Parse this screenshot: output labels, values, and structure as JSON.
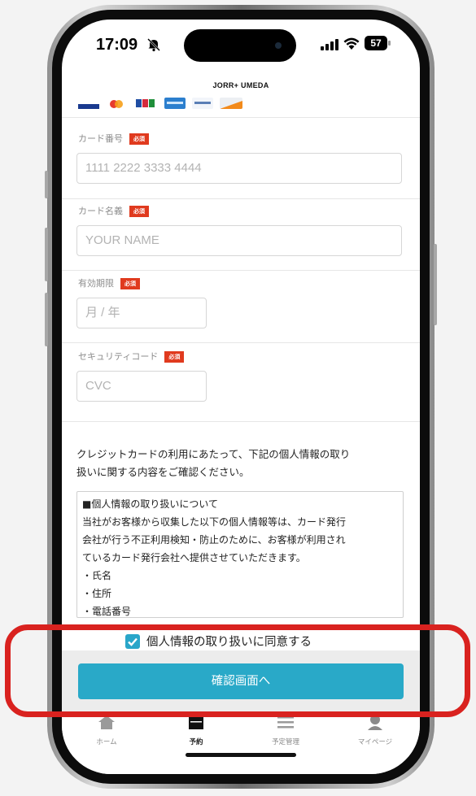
{
  "status_bar": {
    "time": "17:09",
    "battery": "57"
  },
  "header": {
    "title": "JORR+ UMEDA"
  },
  "brands": [
    "visa-logo",
    "mastercard-logo",
    "jcb-logo",
    "amex-logo",
    "diners-logo",
    "discover-logo"
  ],
  "form": {
    "required_badge": "必須",
    "card_number": {
      "label": "カード番号",
      "placeholder": "1111 2222 3333 4444"
    },
    "card_name": {
      "label": "カード名義",
      "placeholder": "YOUR NAME"
    },
    "expiry": {
      "label": "有効期限",
      "placeholder": "月 / 年"
    },
    "cvc": {
      "label": "セキュリティコード",
      "placeholder": "CVC"
    }
  },
  "notice": {
    "line1": "クレジットカードの利用にあたって、下記の個人情報の取り",
    "line2": "扱いに関する内容をご確認ください。"
  },
  "policy": {
    "lines": [
      "■個人情報の取り扱いについて",
      "当社がお客様から収集した以下の個人情報等は、カード発行",
      "会社が行う不正利用検知・防止のために、お客様が利用され",
      "ているカード発行会社へ提供させていただきます。",
      "・氏名",
      "・住所",
      "・電話番号"
    ]
  },
  "agree": {
    "label": "個人情報の取り扱いに同意する",
    "checked": true
  },
  "confirm_button": {
    "label": "確認画面へ"
  },
  "tabs": [
    {
      "label": "ホーム",
      "icon": "home-icon",
      "active": false
    },
    {
      "label": "予約",
      "icon": "calendar-icon",
      "active": true
    },
    {
      "label": "予定管理",
      "icon": "list-icon",
      "active": false
    },
    {
      "label": "マイページ",
      "icon": "person-icon",
      "active": false
    }
  ],
  "colors": {
    "accent": "#29a9c8",
    "required": "#e03a1e",
    "highlight": "#d9221f"
  }
}
